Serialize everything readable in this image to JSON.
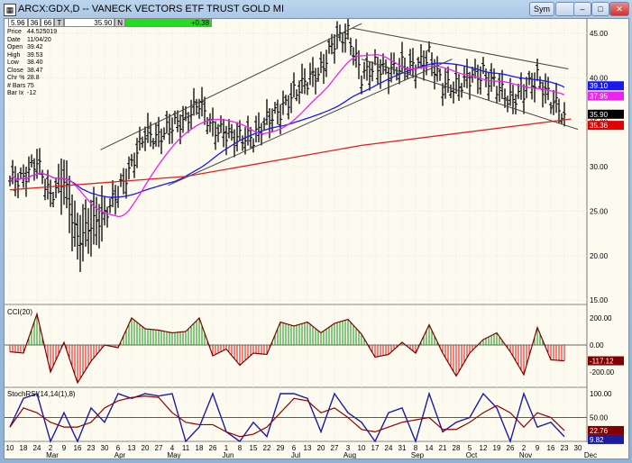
{
  "window": {
    "title": "ARCX:GDX,D -- VANECK VECTORS ETF TRUST GOLD MI",
    "sym_button": "Sym",
    "buttons": [
      "minimize",
      "maximize",
      "close"
    ]
  },
  "quote": {
    "fields": [
      "5.96",
      "36",
      "66",
      "T"
    ],
    "last": "35.90",
    "flag": "N",
    "change": "+0.38"
  },
  "info": [
    [
      "Price",
      "44.525019"
    ],
    [
      "Date",
      "11/04/20"
    ],
    [
      "Open",
      "39.42"
    ],
    [
      "High",
      "39.53"
    ],
    [
      "Low",
      "38.40"
    ],
    [
      "Close",
      "38.47"
    ],
    [
      "Chr %",
      "28.8"
    ],
    [
      "# Bars",
      "75"
    ],
    [
      "Bar Ix",
      "-12"
    ]
  ],
  "colors": {
    "bg": "#fdfbf0",
    "ma200": "#e02020",
    "ma50": "#1a1aee",
    "ma20": "#ee22ee",
    "up": "#109010",
    "down": "#e01010",
    "cciline": "#800000",
    "stoch": "#1c1ca0",
    "signal": "#900000"
  },
  "chart_data": [
    {
      "type": "ohlc",
      "title": "ARCX:GDX,D",
      "ylim": [
        15,
        47
      ],
      "yticks": [
        15,
        20,
        25,
        30,
        35,
        40,
        45
      ],
      "x_week_labels": [
        "10",
        "18",
        "24",
        "2",
        "9",
        "16",
        "23",
        "30",
        "6",
        "13",
        "20",
        "27",
        "4",
        "11",
        "18",
        "26",
        "1",
        "8",
        "15",
        "22",
        "29",
        "6",
        "13",
        "20",
        "27",
        "3",
        "10",
        "17",
        "24",
        "31",
        "8",
        "14",
        "21",
        "28",
        "5",
        "12",
        "19",
        "26",
        "2",
        "9",
        "16",
        "23",
        "30"
      ],
      "months": [
        {
          "label": "Mar",
          "week": 3
        },
        {
          "label": "Apr",
          "week": 8
        },
        {
          "label": "May",
          "week": 12
        },
        {
          "label": "Jun",
          "week": 16
        },
        {
          "label": "Jul",
          "week": 21
        },
        {
          "label": "Aug",
          "week": 25
        },
        {
          "label": "Sep",
          "week": 30
        },
        {
          "label": "Oct",
          "week": 34
        },
        {
          "label": "Nov",
          "week": 38
        },
        {
          "label": "Dec",
          "week": 42.8
        }
      ],
      "weekly_close": [
        28.4,
        28.9,
        30.4,
        26.9,
        28.4,
        22,
        23.3,
        24.8,
        26.9,
        30.4,
        33.5,
        33.5,
        34.5,
        35.5,
        37,
        34.5,
        33.5,
        33.5,
        33,
        35.5,
        36,
        38.5,
        39.5,
        41,
        44,
        45.1,
        40,
        41.5,
        40.5,
        41.5,
        41,
        42.6,
        39,
        39,
        40,
        40.5,
        39,
        37.5,
        38.5,
        40,
        37.5,
        35.9
      ],
      "ma200": [
        [
          0,
          27.4
        ],
        [
          13,
          28.9
        ],
        [
          26,
          32.4
        ],
        [
          41.5,
          35.36
        ]
      ],
      "labels": {
        "ma50": "39.10",
        "ma20": "37.95",
        "last": "35.90",
        "ma200": "35.36"
      },
      "trendlines": [
        [
          [
            6.7,
            31.9
          ],
          [
            26,
            46.1
          ]
        ],
        [
          [
            11.7,
            27.9
          ],
          [
            32.7,
            42.1
          ]
        ],
        [
          [
            25.3,
            45.6
          ],
          [
            41.3,
            41.0
          ]
        ],
        [
          [
            26,
            42.1
          ],
          [
            42,
            34.2
          ]
        ]
      ]
    },
    {
      "type": "bar",
      "title": "CCI(20)",
      "ylim": [
        -300,
        260
      ],
      "yticks": [
        "200.00",
        "0.00",
        "-200.00"
      ],
      "last": "-117.12",
      "values": [
        -50,
        -60,
        230,
        -200,
        20,
        -280,
        -120,
        0,
        -20,
        200,
        120,
        110,
        90,
        100,
        200,
        -80,
        -30,
        -150,
        -60,
        -70,
        170,
        140,
        170,
        90,
        160,
        190,
        80,
        -90,
        -70,
        20,
        -60,
        150,
        -60,
        -230,
        -60,
        40,
        90,
        -50,
        -220,
        130,
        -110,
        -117
      ]
    },
    {
      "type": "line",
      "title": "StochRSI(14,14(1),8)",
      "ylim": [
        0,
        100
      ],
      "yticks": [
        "100.00",
        "50.00",
        "0.00"
      ],
      "last_k": "9.82",
      "last_d": "22.76",
      "k": [
        30,
        90,
        100,
        0,
        60,
        0,
        70,
        40,
        100,
        90,
        100,
        95,
        100,
        0,
        30,
        100,
        20,
        0,
        40,
        10,
        100,
        100,
        90,
        20,
        100,
        60,
        40,
        0,
        60,
        70,
        0,
        100,
        20,
        40,
        50,
        100,
        70,
        0,
        100,
        30,
        40,
        9.82
      ],
      "d": [
        30,
        70,
        60,
        40,
        30,
        30,
        40,
        70,
        85,
        92,
        95,
        92,
        60,
        40,
        35,
        35,
        20,
        10,
        15,
        30,
        60,
        90,
        85,
        60,
        70,
        50,
        25,
        20,
        30,
        40,
        45,
        50,
        25,
        25,
        40,
        60,
        75,
        60,
        30,
        60,
        50,
        22.76
      ]
    }
  ]
}
